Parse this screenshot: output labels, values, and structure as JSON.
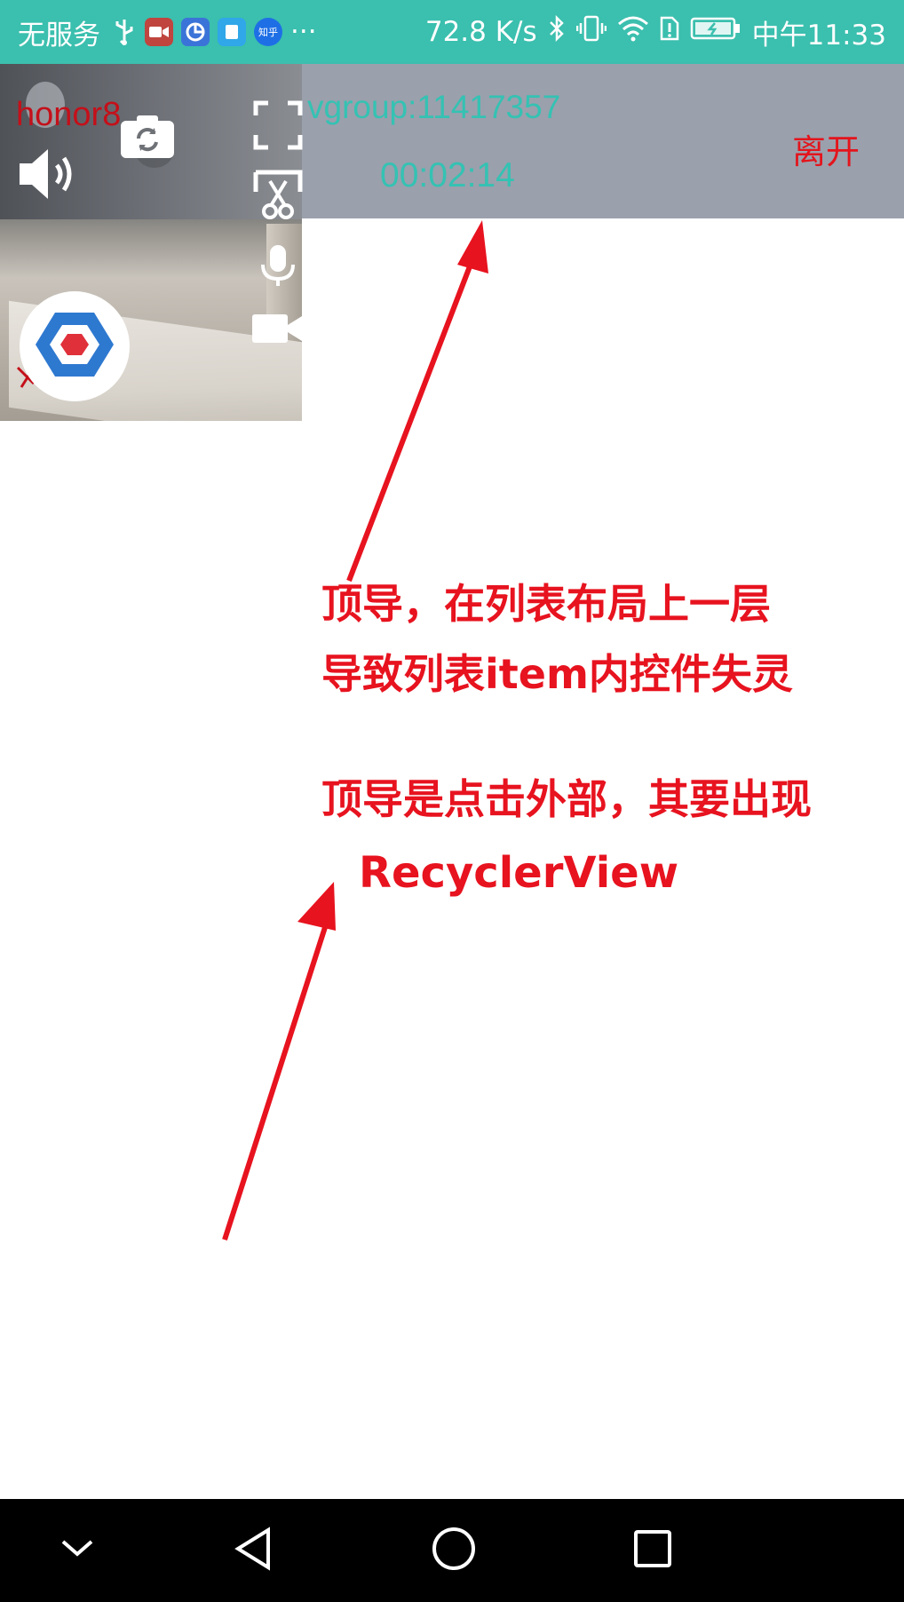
{
  "status_bar": {
    "carrier": "无服务",
    "app_badge_zhihu": "知乎",
    "more": "···",
    "network_speed": "72.8 K/s",
    "time": "中午11:33"
  },
  "call_header": {
    "group_id": "vgroup:11417357",
    "timer": "00:02:14",
    "leave_label": "离开"
  },
  "video_panel": {
    "user_name": "honor8"
  },
  "annotations": {
    "line1": "顶导，在列表布局上一层",
    "line2": "导致列表item内控件失灵",
    "line3": "顶导是点击外部，其要出现",
    "line4": "RecyclerView"
  },
  "colors": {
    "status_bar": "#3bbfae",
    "overlay": "#9aa0ac",
    "accent_teal": "#34c2b3",
    "annotation_red": "#e7131f"
  }
}
